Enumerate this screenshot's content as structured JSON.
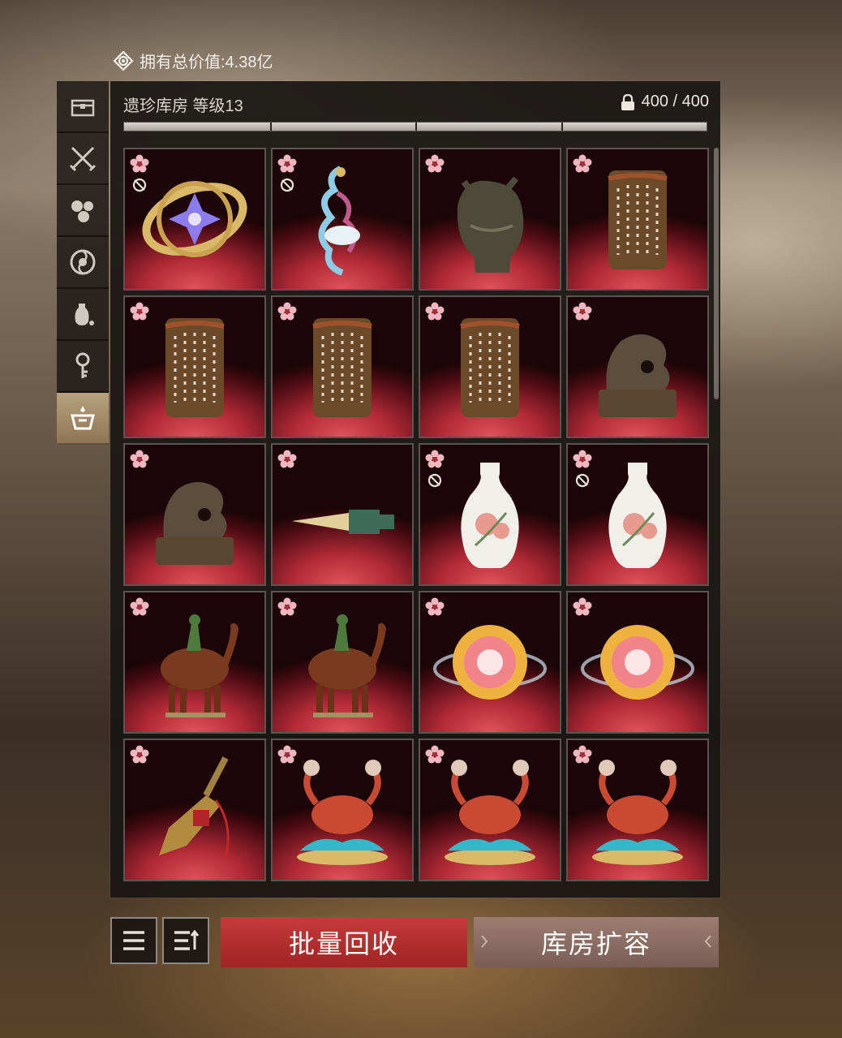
{
  "header": {
    "total_value_label": "拥有总价值:4.38亿"
  },
  "warehouse": {
    "title": "遗珍库房 等级13",
    "capacity": "400 / 400",
    "capacity_fill": 1.0
  },
  "side_tabs": [
    {
      "icon": "chest-icon",
      "active": false
    },
    {
      "icon": "crossed-swords-icon",
      "active": false
    },
    {
      "icon": "gems-icon",
      "active": false
    },
    {
      "icon": "swirl-emblem-icon",
      "active": false
    },
    {
      "icon": "vase-icon",
      "active": false
    },
    {
      "icon": "key-icon",
      "active": false
    },
    {
      "icon": "treasure-altar-icon",
      "active": true
    }
  ],
  "items": [
    {
      "art": "armillary-sphere",
      "bound": true
    },
    {
      "art": "phoenix",
      "bound": true
    },
    {
      "art": "bronze-beast-vessel",
      "bound": false
    },
    {
      "art": "stone-seal",
      "bound": false
    },
    {
      "art": "stone-seal",
      "bound": false
    },
    {
      "art": "stone-seal",
      "bound": false
    },
    {
      "art": "stone-seal",
      "bound": false
    },
    {
      "art": "animal-seal",
      "bound": false
    },
    {
      "art": "animal-seal",
      "bound": false
    },
    {
      "art": "jade-dagger",
      "bound": false
    },
    {
      "art": "porcelain-vase",
      "bound": true
    },
    {
      "art": "porcelain-vase",
      "bound": true
    },
    {
      "art": "camel-rider",
      "bound": false
    },
    {
      "art": "camel-rider",
      "bound": false
    },
    {
      "art": "glowing-orb",
      "bound": false
    },
    {
      "art": "glowing-orb",
      "bound": false
    },
    {
      "art": "ritual-bell",
      "bound": false
    },
    {
      "art": "crab-on-waves",
      "bound": false
    },
    {
      "art": "crab-on-waves",
      "bound": false
    },
    {
      "art": "crab-on-waves",
      "bound": false
    }
  ],
  "buttons": {
    "batch_recycle": "批量回收",
    "expand_warehouse": "库房扩容"
  },
  "colors": {
    "accent_red": "#b52c2c",
    "expand_brown": "#8a6a60",
    "item_bg_red": "#b02a36"
  }
}
